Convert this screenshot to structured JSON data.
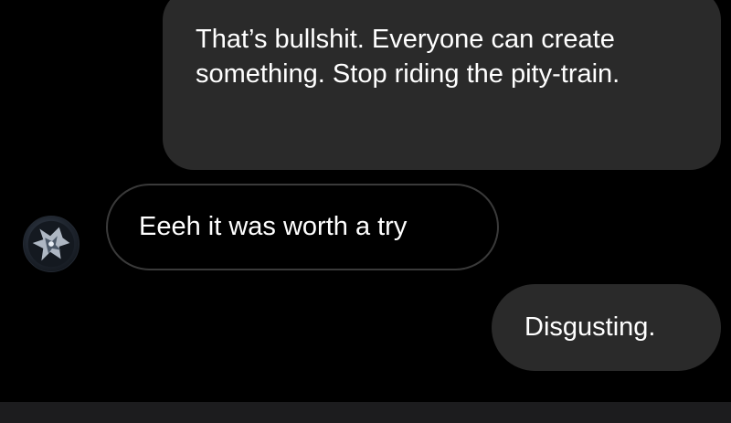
{
  "messages": [
    {
      "direction": "outgoing",
      "text": "That’s bullshit. Everyone can create something. Stop riding the pity-train."
    },
    {
      "direction": "incoming",
      "text": "Eeeh it was worth a try"
    },
    {
      "direction": "outgoing",
      "text": "Disgusting."
    }
  ],
  "colors": {
    "background": "#000000",
    "outgoing_bubble": "#2a2a2a",
    "incoming_bubble_border": "#3a3a3a",
    "text": "#ffffff"
  }
}
